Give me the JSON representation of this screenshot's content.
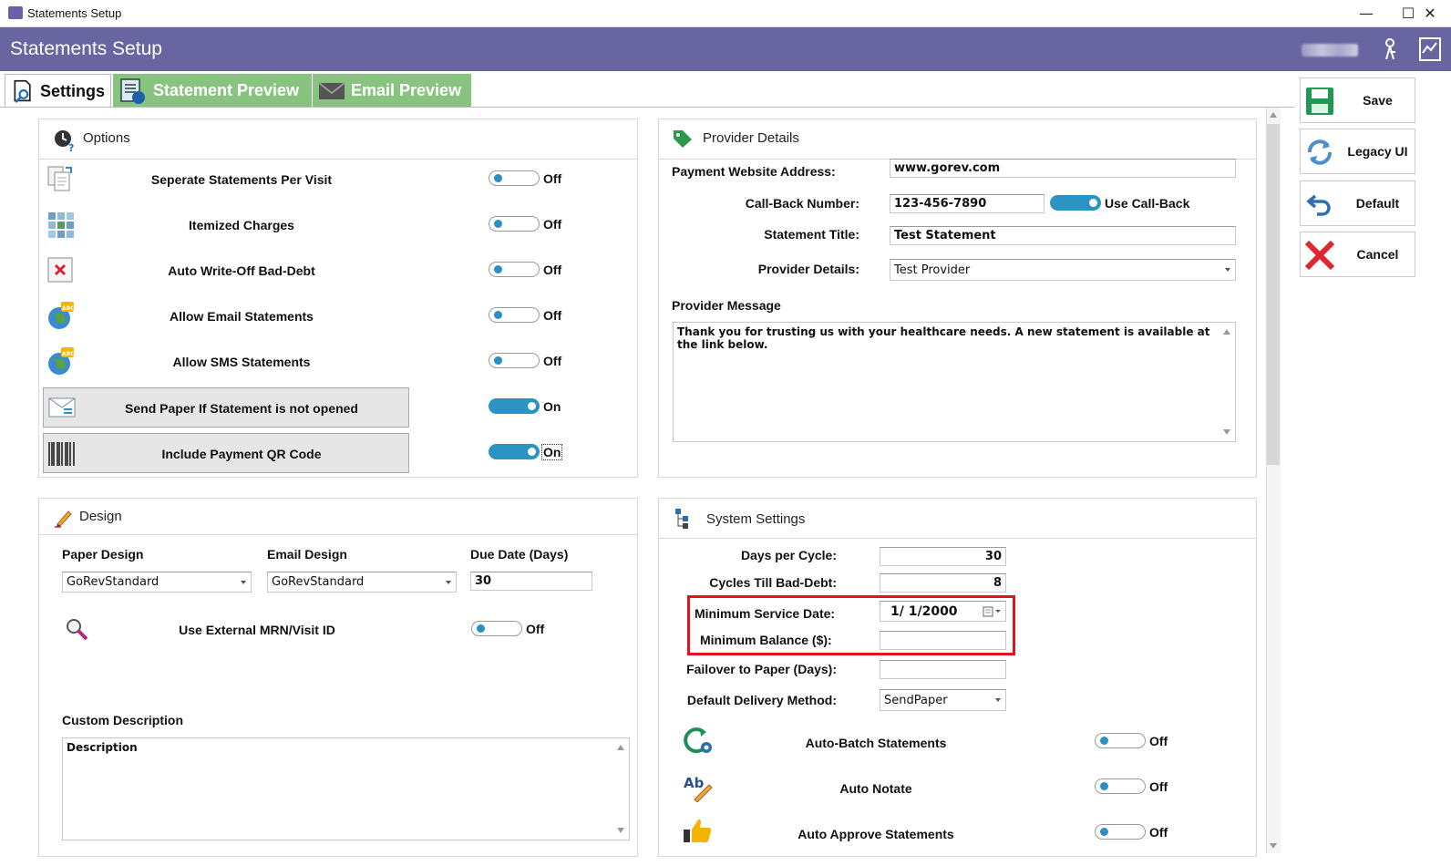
{
  "window": {
    "title": "Statements Setup",
    "minimize": "—",
    "maximize": "☐",
    "close": "✕"
  },
  "header": {
    "title": "Statements Setup"
  },
  "tabs": [
    {
      "label": "Settings"
    },
    {
      "label": "Statement Preview"
    },
    {
      "label": "Email Preview"
    }
  ],
  "actions": {
    "save": "Save",
    "legacy": "Legacy UI",
    "default": "Default",
    "cancel": "Cancel"
  },
  "options": {
    "title": "Options",
    "items": [
      {
        "label": "Seperate Statements Per Visit",
        "state": "Off",
        "on": false
      },
      {
        "label": "Itemized Charges",
        "state": "Off",
        "on": false
      },
      {
        "label": "Auto Write-Off Bad-Debt",
        "state": "Off",
        "on": false
      },
      {
        "label": "Allow Email Statements",
        "state": "Off",
        "on": false
      },
      {
        "label": "Allow SMS Statements",
        "state": "Off",
        "on": false
      },
      {
        "label": "Send Paper If Statement is not opened",
        "state": "On",
        "on": true
      },
      {
        "label": "Include Payment QR Code",
        "state": "On",
        "on": true
      }
    ]
  },
  "provider": {
    "title": "Provider Details",
    "website_label": "Payment Website Address:",
    "website_value": "www.gorev.com",
    "callback_label": "Call-Back Number:",
    "callback_value": "123-456-7890",
    "use_callback_label": "Use Call-Back",
    "statement_title_label": "Statement Title:",
    "statement_title_value": "Test Statement",
    "provider_details_label": "Provider Details:",
    "provider_details_value": "Test Provider",
    "message_label": "Provider Message",
    "message_value": "Thank you for trusting us with your healthcare needs.  A new statement is available at the link below."
  },
  "design": {
    "title": "Design",
    "paper_label": "Paper Design",
    "paper_value": "GoRevStandard",
    "email_label": "Email Design",
    "email_value": "GoRevStandard",
    "due_label": "Due Date (Days)",
    "due_value": "30",
    "external_label": "Use External MRN/Visit ID",
    "external_state": "Off",
    "custom_label": "Custom Description",
    "custom_value": "Description"
  },
  "system": {
    "title": "System Settings",
    "days_cycle_label": "Days per Cycle:",
    "days_cycle_value": "30",
    "cycles_label": "Cycles Till Bad-Debt:",
    "cycles_value": "8",
    "min_date_label": "Minimum Service Date:",
    "min_date_value": "1/  1/2000",
    "min_balance_label": "Minimum Balance ($):",
    "min_balance_value": "",
    "failover_label": "Failover to Paper (Days):",
    "failover_value": "",
    "delivery_label": "Default Delivery Method:",
    "delivery_value": "SendPaper",
    "toggles": [
      {
        "label": "Auto-Batch Statements",
        "state": "Off"
      },
      {
        "label": "Auto Notate",
        "state": "Off"
      },
      {
        "label": "Auto Approve Statements",
        "state": "Off"
      }
    ]
  },
  "colors": {
    "header": "#6865a0",
    "tab_inactive": "#88c47f",
    "toggle_on": "#2b94c3",
    "highlight": "#e0141e"
  }
}
